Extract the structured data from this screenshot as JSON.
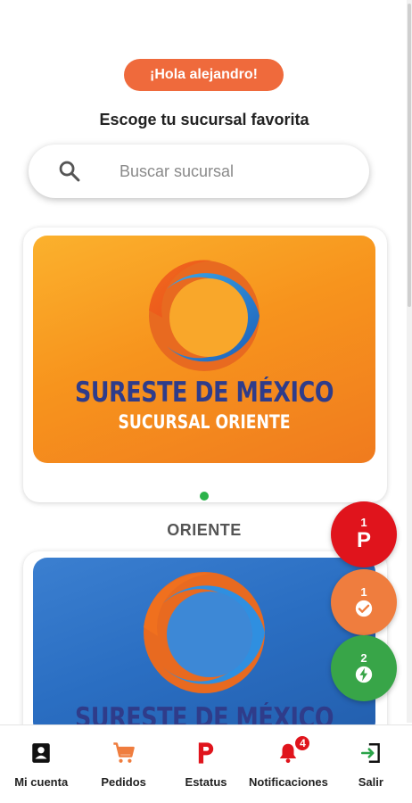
{
  "header": {
    "greeting": "¡Hola alejandro!",
    "subtitle": "Escoge tu sucursal favorita"
  },
  "search": {
    "placeholder": "Buscar sucursal",
    "value": ""
  },
  "branches": [
    {
      "brand_line1": "SURESTE DE MÉXICO",
      "brand_line2": "SUCURSAL ORIENTE",
      "name": "ORIENTE",
      "status_color": "#2bb34a"
    },
    {
      "brand_line1": "SURESTE DE MÉXICO",
      "brand_line2": ""
    }
  ],
  "fabs": [
    {
      "count": "1",
      "label": "P",
      "color": "#e0141c",
      "icon": "p-letter-icon"
    },
    {
      "count": "1",
      "color": "#ef7d3e",
      "icon": "check-clock-icon"
    },
    {
      "count": "2",
      "color": "#38a548",
      "icon": "lightning-icon"
    }
  ],
  "bottom_nav": {
    "items": [
      {
        "label": "Mi cuenta",
        "icon": "account-icon"
      },
      {
        "label": "Pedidos",
        "icon": "cart-icon"
      },
      {
        "label": "Estatus",
        "icon": "p-status-icon"
      },
      {
        "label": "Notificaciones",
        "icon": "bell-icon",
        "badge": "4"
      },
      {
        "label": "Salir",
        "icon": "logout-icon"
      }
    ]
  },
  "colors": {
    "accent": "#ef6a3c",
    "red": "#e0141c",
    "green": "#38a548",
    "orange": "#ef7d3e"
  }
}
